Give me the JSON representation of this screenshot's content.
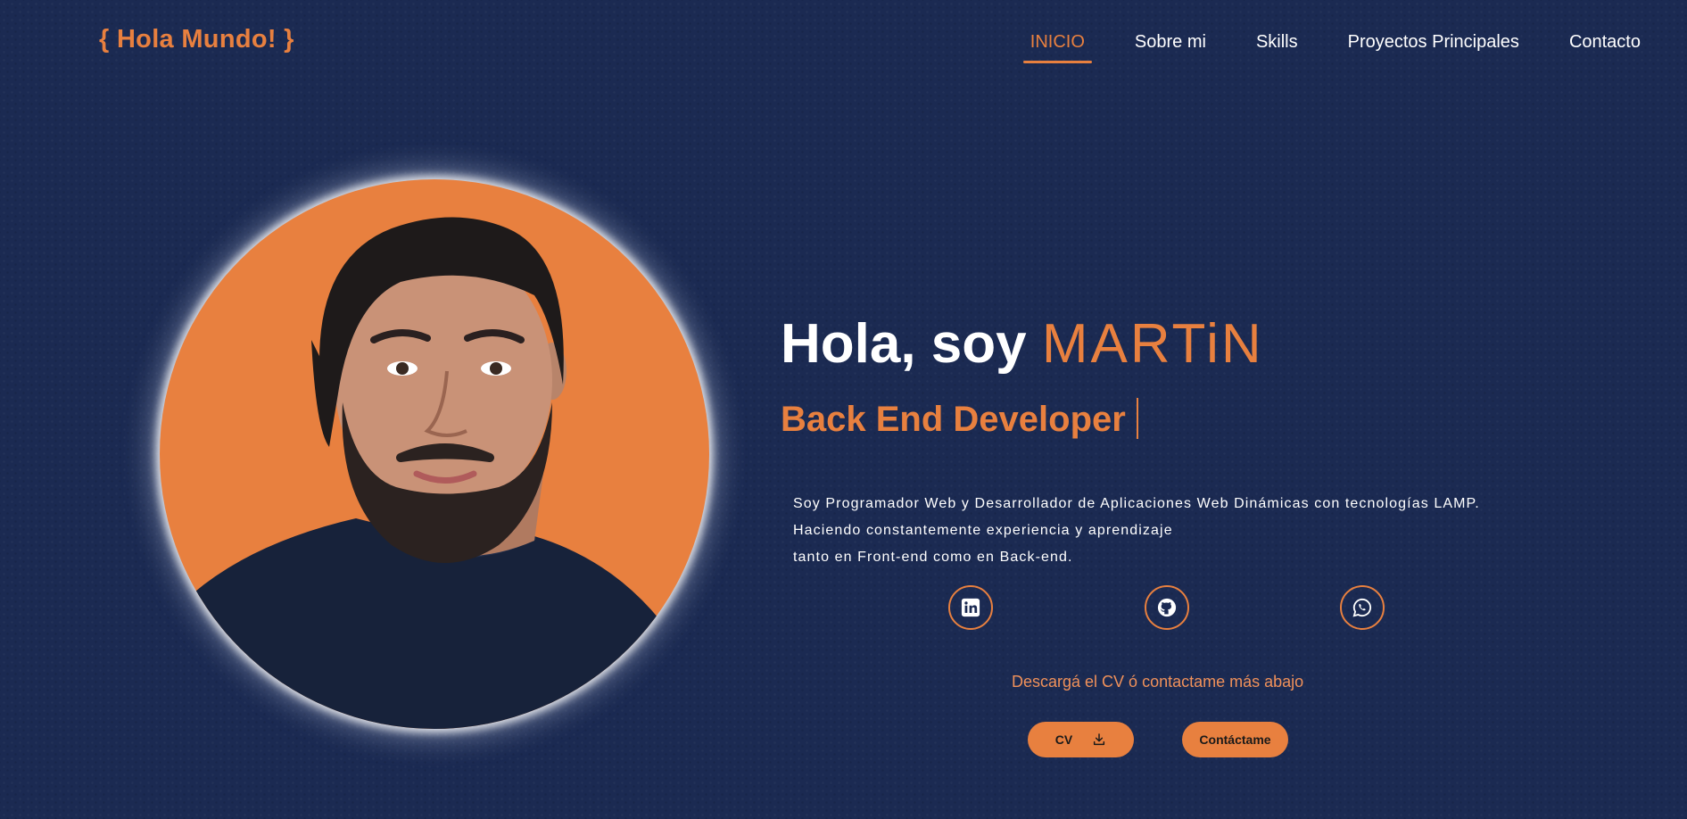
{
  "header": {
    "logo": "{ Hola Mundo! }",
    "nav": [
      {
        "label": "INICIO",
        "active": true
      },
      {
        "label": "Sobre mi",
        "active": false
      },
      {
        "label": "Skills",
        "active": false
      },
      {
        "label": "Proyectos Principales",
        "active": false
      },
      {
        "label": "Contacto",
        "active": false
      }
    ]
  },
  "hero": {
    "greeting": "Hola, soy",
    "name": "MARTiN",
    "role": "Back End Developer",
    "bio": [
      "Soy Programador Web y Desarrollador de Aplicaciones Web Dinámicas con tecnologías LAMP.",
      "Haciendo constantemente experiencia y aprendizaje",
      "tanto en Front-end como en Back-end."
    ],
    "social": [
      {
        "icon": "linkedin-icon"
      },
      {
        "icon": "github-icon"
      },
      {
        "icon": "whatsapp-icon"
      }
    ],
    "cta_text": "Descargá el CV ó contactame más abajo",
    "cv_label": "CV",
    "contact_label": "Contáctame"
  },
  "colors": {
    "background": "#1b2a52",
    "accent": "#e8803f",
    "text": "#ffffff"
  }
}
